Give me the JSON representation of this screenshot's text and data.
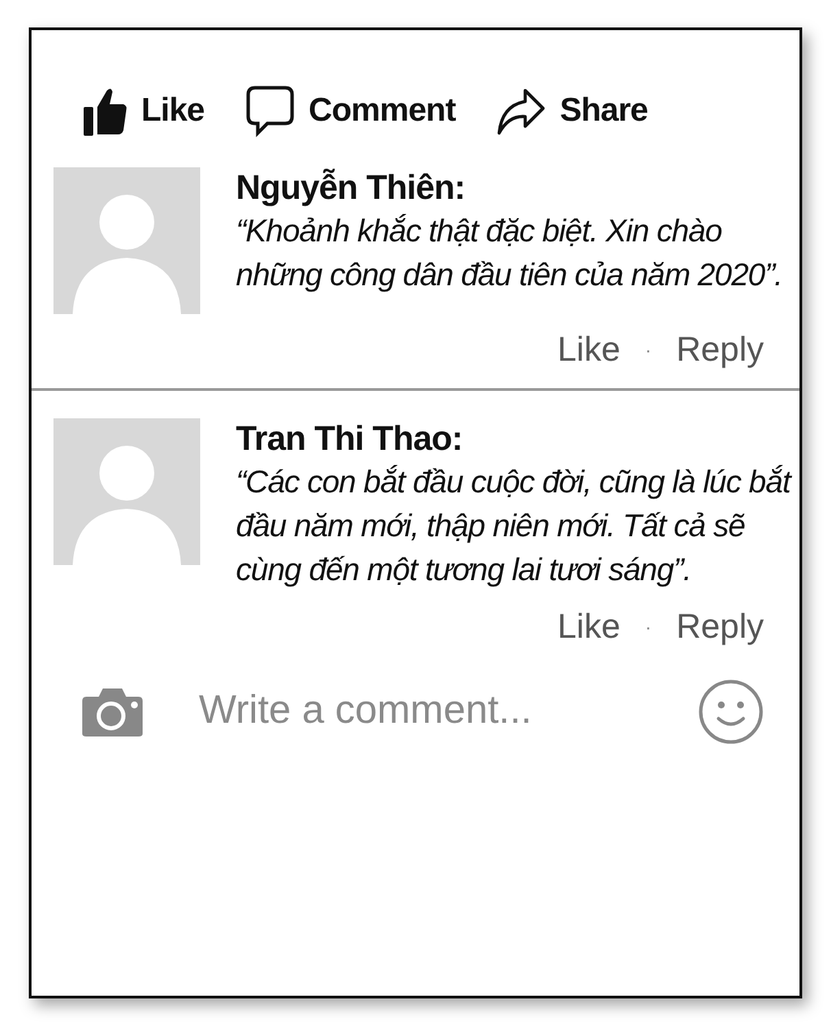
{
  "actions": [
    {
      "kind": "like",
      "label": "Like"
    },
    {
      "kind": "comment",
      "label": "Comment"
    },
    {
      "kind": "share",
      "label": "Share"
    }
  ],
  "comments": [
    {
      "author": "Nguyễn Thiên:",
      "text": "“Khoảnh khắc thật đặc biệt. Xin chào những công dân đầu tiên của năm 2020”.",
      "like": "Like",
      "separator": "·",
      "reply": "Reply"
    },
    {
      "author": "Tran Thi Thao:",
      "text": "“Các con bắt đầu cuộc đời, cũng là lúc bắt đầu năm mới, thập niên mới. Tất cả sẽ cùng đến một tương lai tươi sáng”.",
      "like": "Like",
      "separator": "·",
      "reply": "Reply"
    }
  ],
  "composer": {
    "placeholder": "Write a comment..."
  }
}
